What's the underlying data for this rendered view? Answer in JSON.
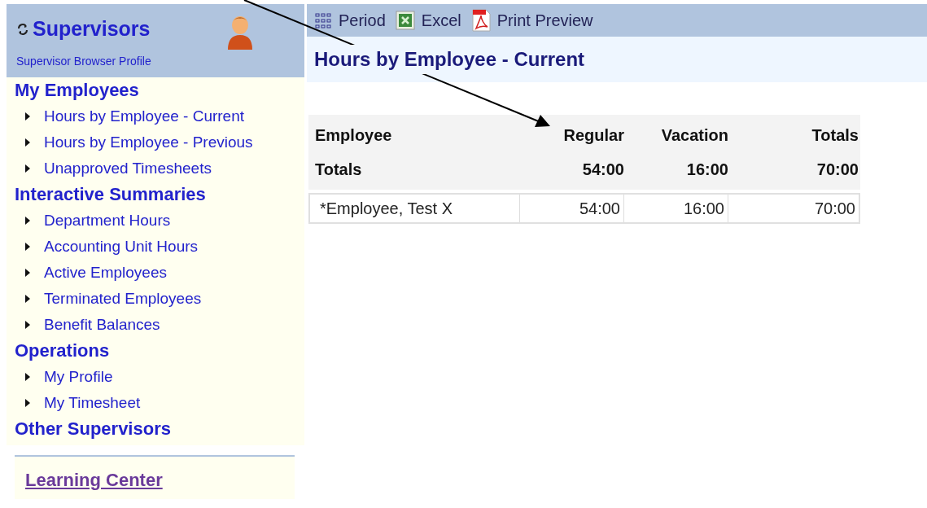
{
  "sidebar": {
    "title": "Supervisors",
    "subtitle": "Supervisor Browser Profile",
    "sections": [
      {
        "heading": "My Employees",
        "items": [
          "Hours by Employee - Current",
          "Hours by Employee - Previous",
          "Unapproved Timesheets"
        ]
      },
      {
        "heading": "Interactive Summaries",
        "items": [
          "Department Hours",
          "Accounting Unit Hours",
          "Active Employees",
          "Terminated Employees",
          "Benefit Balances"
        ]
      },
      {
        "heading": "Operations",
        "items": [
          "My Profile",
          "My Timesheet"
        ]
      },
      {
        "heading": "Other Supervisors"
      }
    ],
    "learning_link": "Learning Center"
  },
  "toolbar": [
    {
      "kind": "period",
      "label": "Period"
    },
    {
      "kind": "excel",
      "label": "Excel"
    },
    {
      "kind": "pdf",
      "label": "Print Preview"
    }
  ],
  "page_title": "Hours by Employee - Current",
  "table": {
    "columns": [
      "Employee",
      "Regular",
      "Vacation",
      "Totals"
    ],
    "totals": [
      "Totals",
      "54:00",
      "16:00",
      "70:00"
    ],
    "rows": [
      [
        "*Employee, Test X",
        "54:00",
        "16:00",
        "70:00"
      ]
    ]
  }
}
